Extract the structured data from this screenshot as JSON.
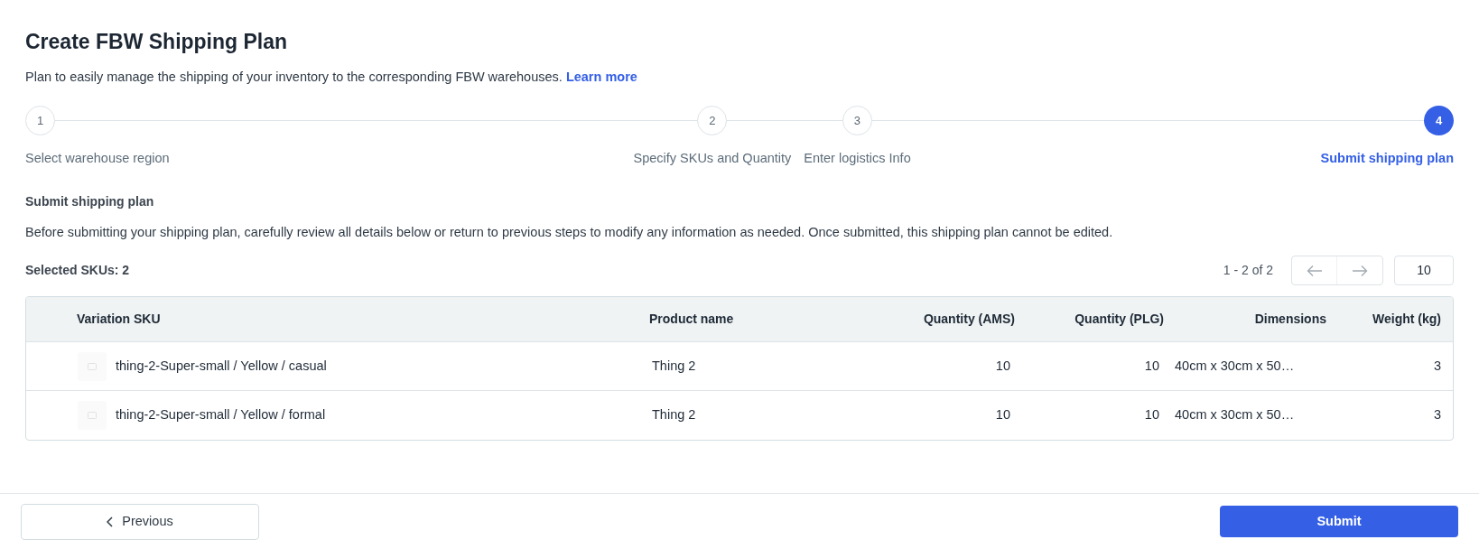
{
  "title": "Create FBW Shipping Plan",
  "description": {
    "text": "Plan to easily manage the shipping of your inventory to the corresponding FBW warehouses.",
    "link": "Learn more"
  },
  "steps": [
    {
      "number": "1",
      "label": "Select warehouse region",
      "selected": false
    },
    {
      "number": "2",
      "label": "Specify SKUs and Quantity",
      "selected": false
    },
    {
      "number": "3",
      "label": "Enter logistics Info",
      "selected": false
    },
    {
      "number": "4",
      "label": "Submit shipping plan",
      "selected": true
    }
  ],
  "section": {
    "heading": "Submit shipping plan",
    "text": "Before submitting your shipping plan, carefully review all details below or return to previous steps to modify any information as needed. Once submitted, this shipping plan cannot be edited."
  },
  "selected_count": "Selected SKUs: 2",
  "pagination": {
    "range": "1 - 2 of 2",
    "page_size": "10"
  },
  "table": {
    "columns": [
      "Variation SKU",
      "Product name",
      "Quantity (AMS)",
      "Quantity (PLG)",
      "Dimensions",
      "Weight (kg)"
    ],
    "rows": [
      [
        "thing-2-Super-small / Yellow / casual",
        "Thing 2",
        "10",
        "10",
        "40cm x 30cm x 50…",
        "3"
      ],
      [
        "thing-2-Super-small / Yellow / formal",
        "Thing 2",
        "10",
        "10",
        "40cm x 30cm x 50…",
        "3"
      ]
    ]
  },
  "footer": {
    "previous": "Previous",
    "submit": "Submit"
  }
}
